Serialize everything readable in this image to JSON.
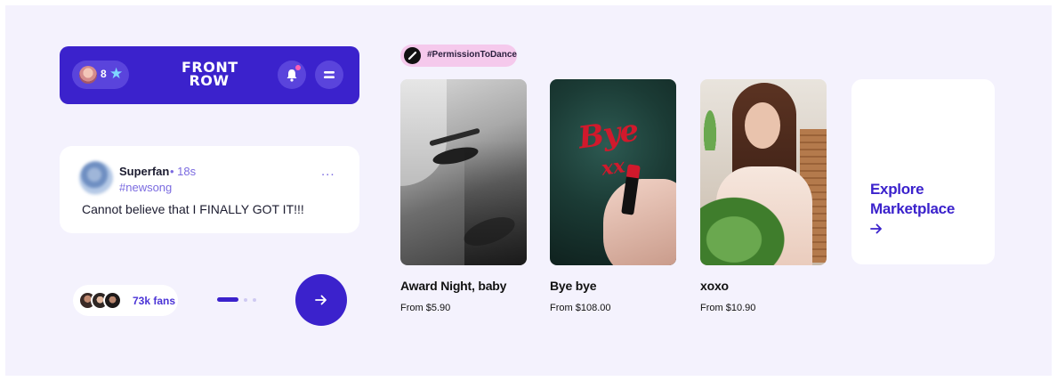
{
  "header": {
    "rank_count": "8",
    "logo_line1": "FRONT",
    "logo_line2": "ROW"
  },
  "post": {
    "author": "Superfan",
    "time": "• 18s",
    "tag": "#newsong",
    "more": "...",
    "text": "Cannot believe that I FINALLY GOT IT!!!"
  },
  "fans": {
    "label": "73k fans"
  },
  "pager": {
    "pages": 3,
    "active_index": 0
  },
  "hashtag": {
    "label": "#PermissionToDance"
  },
  "products": [
    {
      "title": "Award Night, baby",
      "price": "From $5.90"
    },
    {
      "title": "Bye bye",
      "price": "From $108.00",
      "overlay_word": "Bye",
      "overlay_mark": "xx"
    },
    {
      "title": "xoxo",
      "price": "From $10.90"
    }
  ],
  "explore": {
    "title": "Explore Marketplace"
  },
  "colors": {
    "brand": "#3b22cc",
    "background": "#f4f2fd",
    "accent_pink": "#f5c9ec",
    "link": "#7b6be0"
  },
  "icons": {
    "star": "star-icon",
    "bell": "bell-icon",
    "menu": "menu-icon",
    "arrow": "arrow-right-icon"
  }
}
